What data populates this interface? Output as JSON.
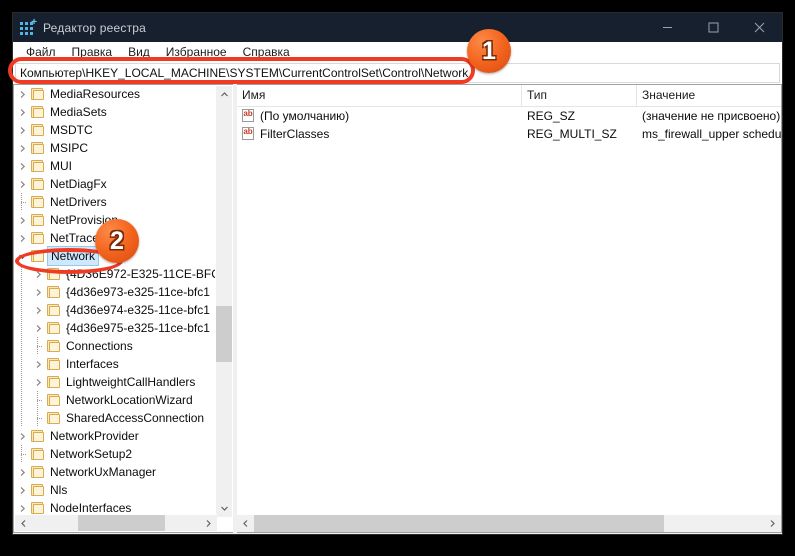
{
  "window": {
    "title": "Редактор реестра",
    "app_icon": "registry-grid-icon",
    "titlebar_color": "#17202e",
    "minimize_label": "Свернуть",
    "maximize_label": "Развернуть",
    "close_label": "Закрыть"
  },
  "menu": {
    "items": [
      {
        "label": "Файл"
      },
      {
        "label": "Правка"
      },
      {
        "label": "Вид"
      },
      {
        "label": "Избранное"
      },
      {
        "label": "Справка"
      }
    ]
  },
  "address": {
    "value": "Компьютер\\HKEY_LOCAL_MACHINE\\SYSTEM\\CurrentControlSet\\Control\\Network",
    "placeholder": "Компьютер\\"
  },
  "tree": {
    "nodes": [
      {
        "label": "MediaResources",
        "indent": 1,
        "expander": "collapsed",
        "selected": false
      },
      {
        "label": "MediaSets",
        "indent": 1,
        "expander": "collapsed",
        "selected": false
      },
      {
        "label": "MSDTC",
        "indent": 1,
        "expander": "collapsed",
        "selected": false
      },
      {
        "label": "MSIPC",
        "indent": 1,
        "expander": "collapsed",
        "selected": false
      },
      {
        "label": "MUI",
        "indent": 1,
        "expander": "collapsed",
        "selected": false
      },
      {
        "label": "NetDiagFx",
        "indent": 1,
        "expander": "collapsed",
        "selected": false
      },
      {
        "label": "NetDrivers",
        "indent": 1,
        "expander": "leaf",
        "selected": false
      },
      {
        "label": "NetProvision",
        "indent": 1,
        "expander": "collapsed",
        "selected": false
      },
      {
        "label": "NetTrace",
        "indent": 1,
        "expander": "collapsed",
        "selected": false
      },
      {
        "label": "Network",
        "indent": 1,
        "expander": "expanded",
        "selected": true
      },
      {
        "label": "{4D36E972-E325-11CE-BFC",
        "indent": 2,
        "expander": "collapsed",
        "selected": false
      },
      {
        "label": "{4d36e973-e325-11ce-bfc1",
        "indent": 2,
        "expander": "collapsed",
        "selected": false
      },
      {
        "label": "{4d36e974-e325-11ce-bfc1",
        "indent": 2,
        "expander": "collapsed",
        "selected": false
      },
      {
        "label": "{4d36e975-e325-11ce-bfc1",
        "indent": 2,
        "expander": "collapsed",
        "selected": false
      },
      {
        "label": "Connections",
        "indent": 2,
        "expander": "leaf",
        "selected": false
      },
      {
        "label": "Interfaces",
        "indent": 2,
        "expander": "collapsed",
        "selected": false
      },
      {
        "label": "LightweightCallHandlers",
        "indent": 2,
        "expander": "collapsed",
        "selected": false
      },
      {
        "label": "NetworkLocationWizard",
        "indent": 2,
        "expander": "leaf",
        "selected": false
      },
      {
        "label": "SharedAccessConnection",
        "indent": 2,
        "expander": "leaf",
        "selected": false
      },
      {
        "label": "NetworkProvider",
        "indent": 1,
        "expander": "collapsed",
        "selected": false
      },
      {
        "label": "NetworkSetup2",
        "indent": 1,
        "expander": "leaf",
        "selected": false
      },
      {
        "label": "NetworkUxManager",
        "indent": 1,
        "expander": "collapsed",
        "selected": false
      },
      {
        "label": "Nls",
        "indent": 1,
        "expander": "collapsed",
        "selected": false
      },
      {
        "label": "NodeInterfaces",
        "indent": 1,
        "expander": "collapsed",
        "selected": false
      }
    ]
  },
  "list": {
    "columns": [
      {
        "label": "Имя"
      },
      {
        "label": "Тип"
      },
      {
        "label": "Значение"
      }
    ],
    "rows": [
      {
        "icon": "string-value-icon",
        "name": "(По умолчанию)",
        "type": "REG_SZ",
        "value": "(значение не присвоено)"
      },
      {
        "icon": "string-value-icon",
        "name": "FilterClasses",
        "type": "REG_MULTI_SZ",
        "value": "ms_firewall_upper schedu"
      }
    ]
  },
  "annotations": {
    "color": "#ef3b24",
    "badges": [
      {
        "label": "1",
        "target": "address-bar"
      },
      {
        "label": "2",
        "target": "tree-node-network"
      }
    ]
  }
}
